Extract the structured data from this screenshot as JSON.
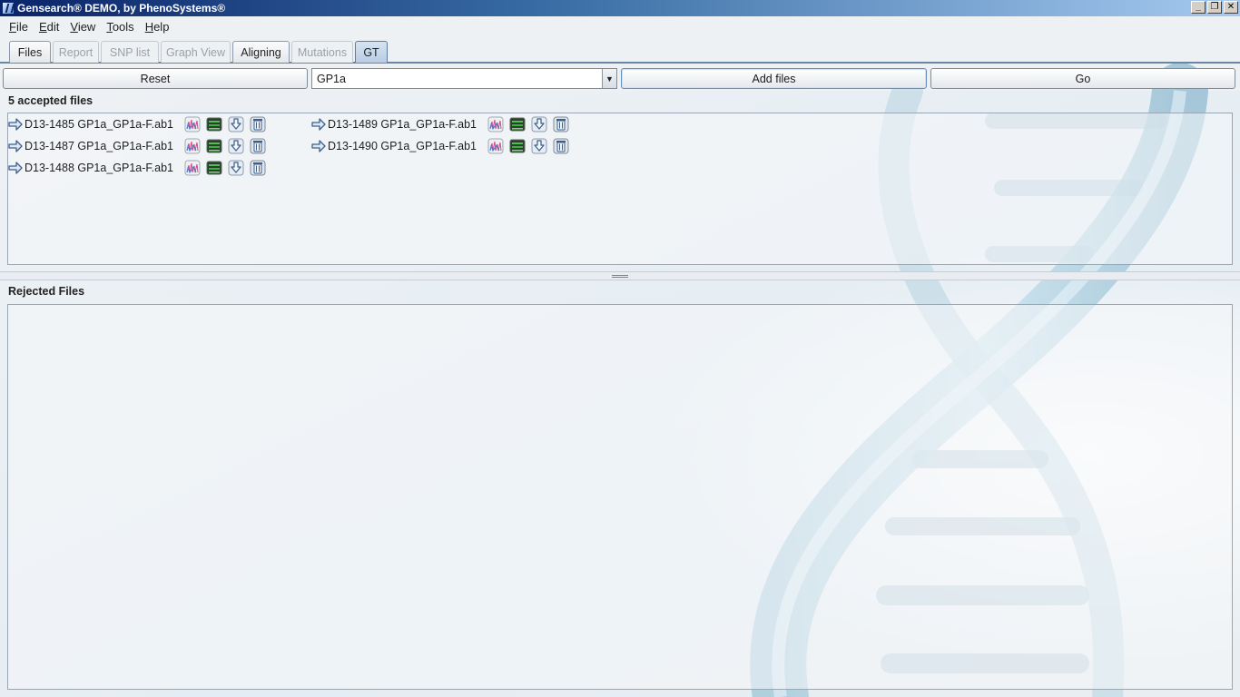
{
  "window": {
    "title": "Gensearch® DEMO, by PhenoSystems®",
    "controls": [
      "_",
      "❐",
      "✕"
    ]
  },
  "menu": [
    {
      "label": "File",
      "mnemonic": "F"
    },
    {
      "label": "Edit",
      "mnemonic": "E"
    },
    {
      "label": "View",
      "mnemonic": "V"
    },
    {
      "label": "Tools",
      "mnemonic": "T"
    },
    {
      "label": "Help",
      "mnemonic": "H"
    }
  ],
  "tabs": [
    {
      "label": "Files",
      "state": "normal"
    },
    {
      "label": "Report",
      "state": "disabled"
    },
    {
      "label": "SNP list",
      "state": "disabled"
    },
    {
      "label": "Graph View",
      "state": "disabled"
    },
    {
      "label": "Aligning",
      "state": "normal"
    },
    {
      "label": "Mutations",
      "state": "disabled"
    },
    {
      "label": "GT",
      "state": "active"
    }
  ],
  "toolbar": {
    "reset_label": "Reset",
    "gene_select_value": "GP1a",
    "add_files_label": "Add files",
    "go_label": "Go"
  },
  "accepted": {
    "title": "5 accepted files",
    "files": [
      "D13-1485 GP1a_GP1a-F.ab1",
      "D13-1489 GP1a_GP1a-F.ab1",
      "D13-1487 GP1a_GP1a-F.ab1",
      "D13-1490 GP1a_GP1a-F.ab1",
      "D13-1488 GP1a_GP1a-F.ab1"
    ],
    "file_actions": [
      "electropherogram-icon",
      "sequence-icon",
      "download-icon",
      "delete-icon"
    ]
  },
  "rejected": {
    "title": "Rejected Files"
  },
  "colors": {
    "titlebar_start": "#0a246a",
    "titlebar_end": "#a6caf0",
    "tab_active": "#b9cde4",
    "dna_blue": "#7fc0dc"
  }
}
